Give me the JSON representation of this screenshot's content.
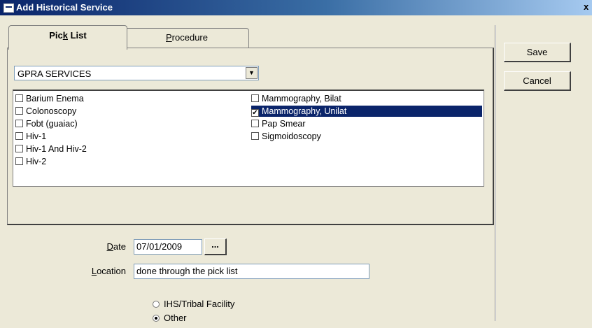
{
  "window": {
    "title": "Add Historical Service",
    "close_glyph": "x",
    "icon": "window-app-icon"
  },
  "tabs": [
    {
      "label_pre": "Pic",
      "label_accel": "k",
      "label_post": " List",
      "active": true
    },
    {
      "label_pre": "",
      "label_accel": "P",
      "label_post": "rocedure",
      "active": false
    }
  ],
  "category_select": {
    "value": "GPRA SERVICES",
    "icon": "chevron-down-icon"
  },
  "services": {
    "left": [
      {
        "label": "Barium Enema",
        "checked": false
      },
      {
        "label": "Colonoscopy",
        "checked": false
      },
      {
        "label": "Fobt (guaiac)",
        "checked": false
      },
      {
        "label": "Hiv-1",
        "checked": false
      },
      {
        "label": "Hiv-1 And Hiv-2",
        "checked": false
      },
      {
        "label": "Hiv-2",
        "checked": false
      }
    ],
    "right": [
      {
        "label": "Mammography, Bilat",
        "checked": false
      },
      {
        "label": "Mammography, Unilat",
        "checked": true,
        "selected": true
      },
      {
        "label": "Pap Smear",
        "checked": false
      },
      {
        "label": "Sigmoidoscopy",
        "checked": false
      }
    ]
  },
  "date": {
    "label_accel": "D",
    "label_post": "ate",
    "value": "07/01/2009",
    "button_label": "..."
  },
  "location": {
    "label_accel": "L",
    "label_post": "ocation",
    "value": "done through the pick list"
  },
  "facility_options": [
    {
      "label": "IHS/Tribal Facility",
      "selected": false
    },
    {
      "label": "Other",
      "selected": true
    }
  ],
  "actions": {
    "save": "Save",
    "cancel": "Cancel"
  },
  "colors": {
    "selection": "#0a246a",
    "dialog_bg": "#ece9d8",
    "title_start": "#0a246a"
  }
}
